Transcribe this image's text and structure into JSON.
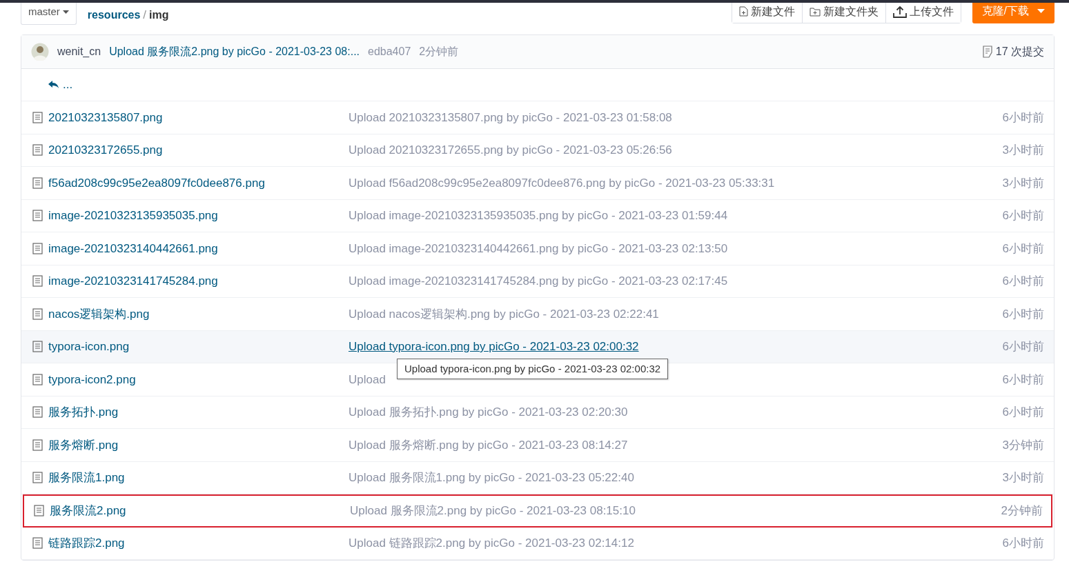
{
  "branch": {
    "label": "master"
  },
  "breadcrumb": [
    {
      "label": "resources",
      "current": false
    },
    {
      "label": "img",
      "current": true
    }
  ],
  "breadcrumb_separator": "/",
  "actions": [
    {
      "label": "新建文件",
      "kind": "file"
    },
    {
      "label": "新建文件夹",
      "kind": "folder"
    },
    {
      "label": "上传文件",
      "kind": "upload"
    }
  ],
  "clone_button": {
    "label": "克隆/下载"
  },
  "last_commit": {
    "author": "wenit_cn",
    "message": "Upload 服务限流2.png by picGo - 2021-03-23 08:...",
    "hash": "edba407",
    "time": "2分钟前",
    "commit_count": "17 次提交"
  },
  "parent_link": {
    "label": "..."
  },
  "files": [
    {
      "name": "20210323135807.png",
      "message": "Upload 20210323135807.png by picGo - 2021-03-23 01:58:08",
      "time": "6小时前",
      "hovered": false,
      "highlighted": false
    },
    {
      "name": "20210323172655.png",
      "message": "Upload 20210323172655.png by picGo - 2021-03-23 05:26:56",
      "time": "3小时前",
      "hovered": false,
      "highlighted": false
    },
    {
      "name": "f56ad208c99c95e2ea8097fc0dee876.png",
      "message": "Upload f56ad208c99c95e2ea8097fc0dee876.png by picGo - 2021-03-23 05:33:31",
      "time": "3小时前",
      "hovered": false,
      "highlighted": false
    },
    {
      "name": "image-20210323135935035.png",
      "message": "Upload image-20210323135935035.png by picGo - 2021-03-23 01:59:44",
      "time": "6小时前",
      "hovered": false,
      "highlighted": false
    },
    {
      "name": "image-20210323140442661.png",
      "message": "Upload image-20210323140442661.png by picGo - 2021-03-23 02:13:50",
      "time": "6小时前",
      "hovered": false,
      "highlighted": false
    },
    {
      "name": "image-20210323141745284.png",
      "message": "Upload image-20210323141745284.png by picGo - 2021-03-23 02:17:45",
      "time": "6小时前",
      "hovered": false,
      "highlighted": false
    },
    {
      "name": "nacos逻辑架构.png",
      "message": "Upload nacos逻辑架构.png by picGo - 2021-03-23 02:22:41",
      "time": "6小时前",
      "hovered": false,
      "highlighted": false
    },
    {
      "name": "typora-icon.png",
      "message": "Upload typora-icon.png by picGo - 2021-03-23 02:00:32",
      "time": "6小时前",
      "hovered": true,
      "highlighted": false,
      "tooltip": "Upload typora-icon.png by picGo - 2021-03-23 02:00:32"
    },
    {
      "name": "typora-icon2.png",
      "message": "Upload",
      "time": "6小时前",
      "hovered": false,
      "highlighted": false
    },
    {
      "name": "服务拓扑.png",
      "message": "Upload 服务拓扑.png by picGo - 2021-03-23 02:20:30",
      "time": "6小时前",
      "hovered": false,
      "highlighted": false
    },
    {
      "name": "服务熔断.png",
      "message": "Upload 服务熔断.png by picGo - 2021-03-23 08:14:27",
      "time": "3分钟前",
      "hovered": false,
      "highlighted": false
    },
    {
      "name": "服务限流1.png",
      "message": "Upload 服务限流1.png by picGo - 2021-03-23 05:22:40",
      "time": "3小时前",
      "hovered": false,
      "highlighted": false
    },
    {
      "name": "服务限流2.png",
      "message": "Upload 服务限流2.png by picGo - 2021-03-23 08:15:10",
      "time": "2分钟前",
      "hovered": false,
      "highlighted": true
    },
    {
      "name": "链路跟踪2.png",
      "message": "Upload 链路跟踪2.png by picGo - 2021-03-23 02:14:12",
      "time": "6小时前",
      "hovered": false,
      "highlighted": false
    }
  ]
}
